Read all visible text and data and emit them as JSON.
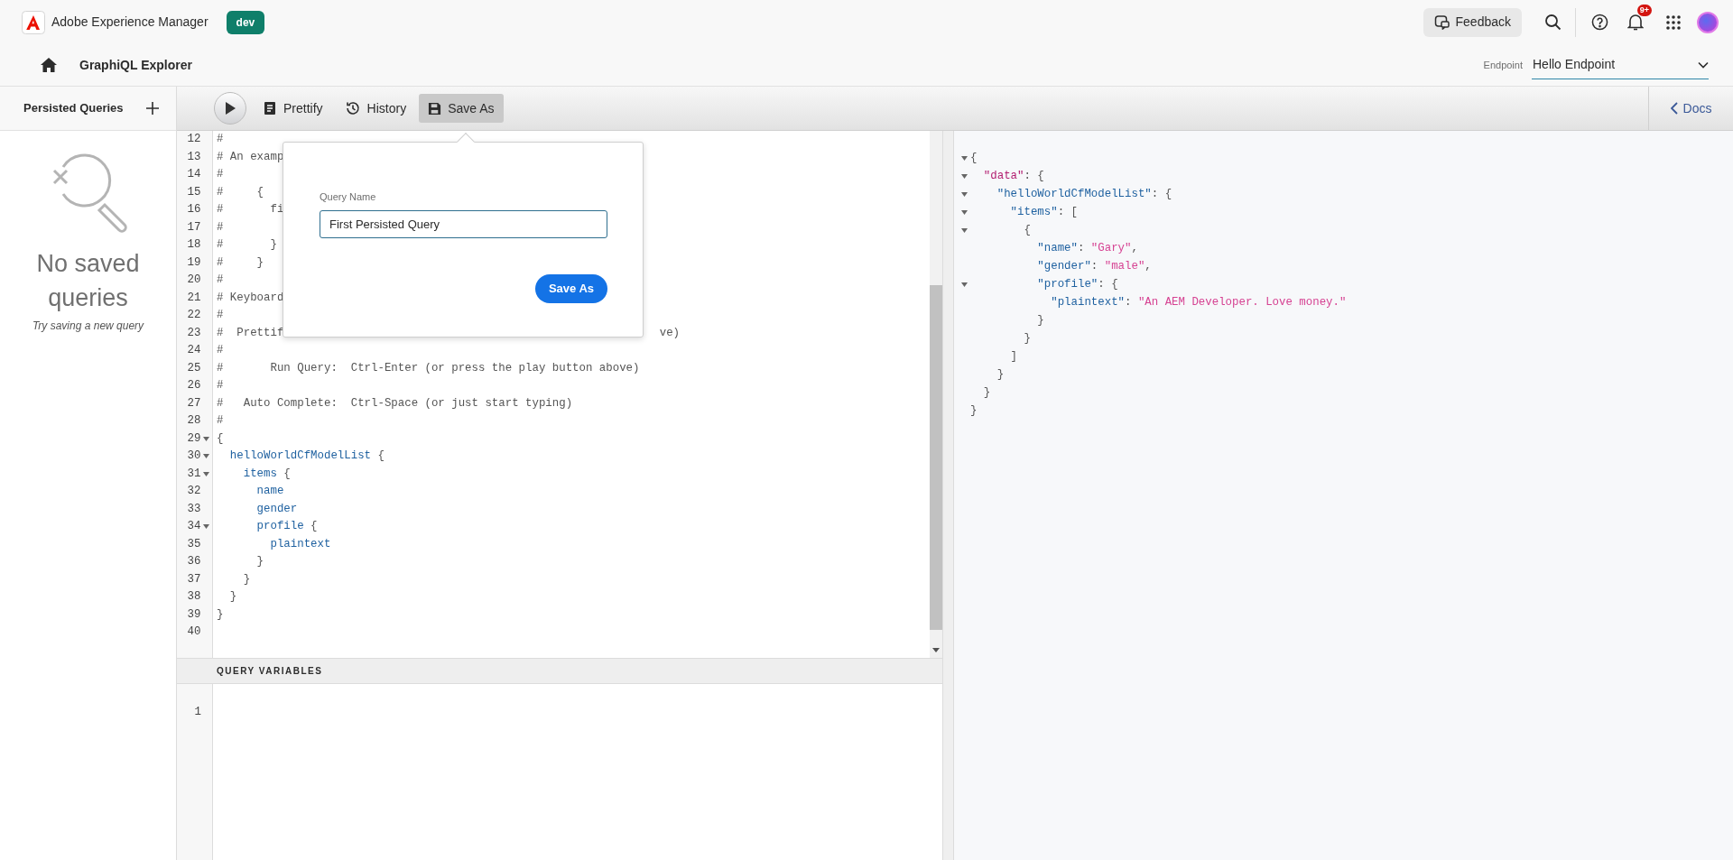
{
  "header": {
    "product": "Adobe Experience Manager",
    "env_badge": "dev",
    "feedback": "Feedback",
    "notifications_badge": "9+"
  },
  "subheader": {
    "title": "GraphiQL Explorer",
    "endpoint_label": "Endpoint",
    "endpoint_value": "Hello Endpoint"
  },
  "sidebar": {
    "title": "Persisted Queries",
    "empty_title": "No saved queries",
    "empty_hint": "Try saving a new query"
  },
  "toolbar": {
    "buttons": [
      {
        "kind": "prettify",
        "label": "Prettify",
        "selected": false
      },
      {
        "kind": "history",
        "label": "History",
        "selected": false
      },
      {
        "kind": "save",
        "label": "Save As",
        "selected": true
      }
    ],
    "docs": "Docs"
  },
  "editor": {
    "lines": [
      {
        "number": "12",
        "foldable": false,
        "tokens": [
          {
            "kind": "comment",
            "text": "#"
          }
        ]
      },
      {
        "number": "13",
        "foldable": false,
        "tokens": [
          {
            "kind": "comment",
            "text": "# An examp"
          }
        ]
      },
      {
        "number": "14",
        "foldable": false,
        "tokens": [
          {
            "kind": "comment",
            "text": "#"
          }
        ]
      },
      {
        "number": "15",
        "foldable": false,
        "tokens": [
          {
            "kind": "comment",
            "text": "#     {"
          }
        ]
      },
      {
        "number": "16",
        "foldable": false,
        "tokens": [
          {
            "kind": "comment",
            "text": "#       fi"
          }
        ]
      },
      {
        "number": "17",
        "foldable": false,
        "tokens": [
          {
            "kind": "comment",
            "text": "#"
          }
        ]
      },
      {
        "number": "18",
        "foldable": false,
        "tokens": [
          {
            "kind": "comment",
            "text": "#       }"
          }
        ]
      },
      {
        "number": "19",
        "foldable": false,
        "tokens": [
          {
            "kind": "comment",
            "text": "#     }"
          }
        ]
      },
      {
        "number": "20",
        "foldable": false,
        "tokens": [
          {
            "kind": "comment",
            "text": "#"
          }
        ]
      },
      {
        "number": "21",
        "foldable": false,
        "tokens": [
          {
            "kind": "comment",
            "text": "# Keyboard"
          }
        ]
      },
      {
        "number": "22",
        "foldable": false,
        "tokens": [
          {
            "kind": "comment",
            "text": "#"
          }
        ]
      },
      {
        "number": "23",
        "foldable": false,
        "tokens": [
          {
            "kind": "comment",
            "text": "#  Prettif"
          },
          {
            "kind": "comment_tail",
            "text": "ve)"
          }
        ]
      },
      {
        "number": "24",
        "foldable": false,
        "tokens": [
          {
            "kind": "comment",
            "text": "#"
          }
        ]
      },
      {
        "number": "25",
        "foldable": false,
        "tokens": [
          {
            "kind": "comment",
            "text": "#       Run Query:  Ctrl-Enter (or press the play button above)"
          }
        ]
      },
      {
        "number": "26",
        "foldable": false,
        "tokens": [
          {
            "kind": "comment",
            "text": "#"
          }
        ]
      },
      {
        "number": "27",
        "foldable": false,
        "tokens": [
          {
            "kind": "comment",
            "text": "#   Auto Complete:  Ctrl-Space (or just start typing)"
          }
        ]
      },
      {
        "number": "28",
        "foldable": false,
        "tokens": [
          {
            "kind": "comment",
            "text": "#"
          }
        ]
      },
      {
        "number": "29",
        "foldable": true,
        "tokens": [
          {
            "kind": "punct",
            "text": "{"
          }
        ]
      },
      {
        "number": "30",
        "foldable": true,
        "tokens": [
          {
            "kind": "field",
            "text": "  helloWorldCfModelList"
          },
          {
            "kind": "punct",
            "text": " {"
          }
        ]
      },
      {
        "number": "31",
        "foldable": true,
        "tokens": [
          {
            "kind": "field",
            "text": "    items"
          },
          {
            "kind": "punct",
            "text": " {"
          }
        ]
      },
      {
        "number": "32",
        "foldable": false,
        "tokens": [
          {
            "kind": "field",
            "text": "      name"
          }
        ]
      },
      {
        "number": "33",
        "foldable": false,
        "tokens": [
          {
            "kind": "field",
            "text": "      gender"
          }
        ]
      },
      {
        "number": "34",
        "foldable": true,
        "tokens": [
          {
            "kind": "field",
            "text": "      profile"
          },
          {
            "kind": "punct",
            "text": " {"
          }
        ]
      },
      {
        "number": "35",
        "foldable": false,
        "tokens": [
          {
            "kind": "field",
            "text": "        plaintext"
          }
        ]
      },
      {
        "number": "36",
        "foldable": false,
        "tokens": [
          {
            "kind": "punct",
            "text": "      }"
          }
        ]
      },
      {
        "number": "37",
        "foldable": false,
        "tokens": [
          {
            "kind": "punct",
            "text": "    }"
          }
        ]
      },
      {
        "number": "38",
        "foldable": false,
        "tokens": [
          {
            "kind": "punct",
            "text": "  }"
          }
        ]
      },
      {
        "number": "39",
        "foldable": false,
        "tokens": [
          {
            "kind": "punct",
            "text": "}"
          }
        ]
      },
      {
        "number": "40",
        "foldable": false
      }
    ]
  },
  "variables": {
    "title": "QUERY VARIABLES",
    "lines": [
      {
        "number": "1"
      }
    ]
  },
  "popover": {
    "field_label": "Query Name",
    "field_value": "First Persisted Query",
    "button": "Save As"
  },
  "result": {
    "lines": [
      {
        "foldable": true,
        "tokens": [
          {
            "kind": "punct",
            "text": "{"
          }
        ]
      },
      {
        "foldable": true,
        "tokens": [
          {
            "kind": "root_key",
            "text": "  \"data\""
          },
          {
            "kind": "punct",
            "text": ": {"
          }
        ]
      },
      {
        "foldable": true,
        "tokens": [
          {
            "kind": "key",
            "text": "    \"helloWorldCfModelList\""
          },
          {
            "kind": "punct",
            "text": ": {"
          }
        ]
      },
      {
        "foldable": true,
        "tokens": [
          {
            "kind": "key",
            "text": "      \"items\""
          },
          {
            "kind": "punct",
            "text": ": ["
          }
        ]
      },
      {
        "foldable": true,
        "tokens": [
          {
            "kind": "punct",
            "text": "        {"
          }
        ]
      },
      {
        "foldable": false,
        "tokens": [
          {
            "kind": "key",
            "text": "          \"name\""
          },
          {
            "kind": "punct",
            "text": ": "
          },
          {
            "kind": "string",
            "text": "\"Gary\""
          },
          {
            "kind": "punct",
            "text": ","
          }
        ]
      },
      {
        "foldable": false,
        "tokens": [
          {
            "kind": "key",
            "text": "          \"gender\""
          },
          {
            "kind": "punct",
            "text": ": "
          },
          {
            "kind": "string",
            "text": "\"male\""
          },
          {
            "kind": "punct",
            "text": ","
          }
        ]
      },
      {
        "foldable": true,
        "tokens": [
          {
            "kind": "key",
            "text": "          \"profile\""
          },
          {
            "kind": "punct",
            "text": ": {"
          }
        ]
      },
      {
        "foldable": false,
        "tokens": [
          {
            "kind": "key",
            "text": "            \"plaintext\""
          },
          {
            "kind": "punct",
            "text": ": "
          },
          {
            "kind": "string",
            "text": "\"An AEM Developer. Love money.\""
          }
        ]
      },
      {
        "foldable": false,
        "tokens": [
          {
            "kind": "punct",
            "text": "          }"
          }
        ]
      },
      {
        "foldable": false,
        "tokens": [
          {
            "kind": "punct",
            "text": "        }"
          }
        ]
      },
      {
        "foldable": false,
        "tokens": [
          {
            "kind": "punct",
            "text": "      ]"
          }
        ]
      },
      {
        "foldable": false,
        "tokens": [
          {
            "kind": "punct",
            "text": "    }"
          }
        ]
      },
      {
        "foldable": false,
        "tokens": [
          {
            "kind": "punct",
            "text": "  }"
          }
        ]
      },
      {
        "foldable": false,
        "tokens": [
          {
            "kind": "punct",
            "text": "}"
          }
        ]
      }
    ]
  }
}
